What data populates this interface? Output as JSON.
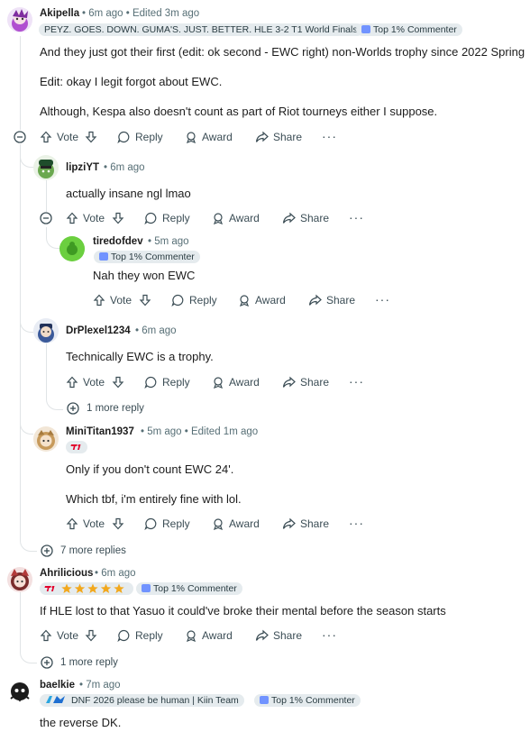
{
  "comments": [
    {
      "user": "Akipella",
      "meta": "• 6m ago • Edited 3m ago",
      "flair_text": "PEYZ. GOES. DOWN. GUMA'S. JUST. BETTER. HLE 3-2 T1 World Finals",
      "badge": "Top 1% Commenter",
      "lines": [
        "And they just got their first (edit: ok second - EWC right) non-Worlds trophy since 2022 Spring",
        "Edit: okay I legit forgot about EWC.",
        "Although, Kespa also doesn't count as part of Riot tourneys either I suppose."
      ]
    },
    {
      "user": "lipziYT",
      "meta": "• 6m ago",
      "lines": [
        "actually insane ngl lmao"
      ]
    },
    {
      "user": "tiredofdev",
      "meta": "• 5m ago",
      "badge": "Top 1% Commenter",
      "lines": [
        "Nah they won EWC"
      ]
    },
    {
      "user": "DrPlexel1234",
      "meta": "• 6m ago",
      "lines": [
        "Technically EWC is a trophy."
      ]
    },
    {
      "user": "MiniTitan1937",
      "meta": "• 5m ago • Edited 1m ago",
      "lines": [
        "Only if you don't count EWC 24'.",
        "Which tbf, i'm entirely fine with lol."
      ]
    },
    {
      "user": "Ahrilicious",
      "meta": "• 6m ago",
      "badge": "Top 1% Commenter",
      "lines": [
        "If HLE lost to that Yasuo it could've broke their mental before the season starts"
      ]
    },
    {
      "user": "baelkie",
      "meta": "• 7m ago",
      "flair_text": "DNF 2026 please be human | Kiin Team",
      "badge": "Top 1% Commenter",
      "lines": [
        "the reverse DK."
      ]
    }
  ],
  "actions": {
    "vote": "Vote",
    "reply": "Reply",
    "award": "Award",
    "share": "Share",
    "more": "···"
  },
  "more_replies": {
    "one": "1 more reply",
    "seven": "7 more replies"
  },
  "colors": {
    "flair_bg": "#e5ebee",
    "thread": "#e0e4e6",
    "t1_red": "#e2012d"
  }
}
